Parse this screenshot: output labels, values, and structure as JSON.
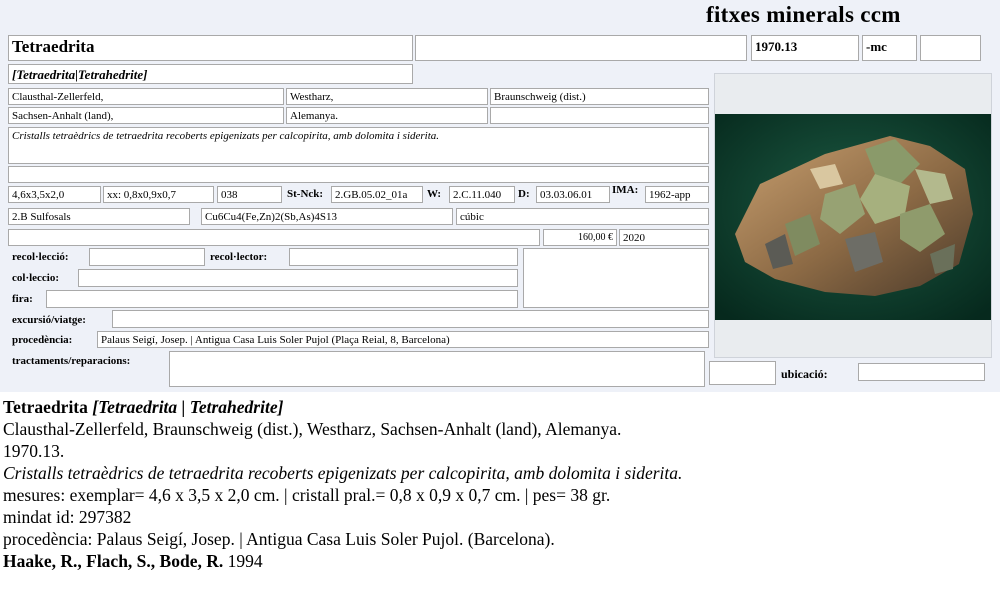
{
  "brand": "fitxes minerals ccm",
  "card": {
    "name": "Tetraedrita",
    "catalog": "1970.13",
    "suffix": "-mc",
    "synonyms": "[Tetraedrita|Tetrahedrite]",
    "locality": [
      "Clausthal-Zellerfeld,",
      "Westharz,",
      "Braunschweig (dist.)"
    ],
    "region": [
      "Sachsen-Anhalt (land),",
      "Alemanya."
    ],
    "description": "Cristalls tetraèdrics de tetraedrita recoberts epigenizats per calcopirita, amb dolomita i siderita.",
    "measures": {
      "size": "4,6x3,5x2,0",
      "crystal": "xx: 0,8x0,9x0,7",
      "weight": "038",
      "strunz_label": "St-Nck:",
      "strunz": "2.GB.05.02_01a",
      "w_label": "W:",
      "w": "2.C.11.040",
      "d_label": "D:",
      "d": "03.03.06.01",
      "ima_label": "IMA:",
      "ima": "1962-app"
    },
    "classification": {
      "group": "2.B Sulfosals",
      "formula": "Cu6Cu4(Fe,Zn)2(Sb,As)4S13",
      "system": "cúbic"
    },
    "price": "160,00 €",
    "year": "2020",
    "labels": {
      "recollection": "recol·lecció:",
      "collector": "recol·lector:",
      "collection": "col·leccio:",
      "fair": "fira:",
      "trip": "excursió/viatge:",
      "provenance": "procedència:",
      "treatments": "tractaments/reparacions:",
      "location": "ubicació:"
    },
    "provenance": "Palaus Seigí, Josep. | Antigua Casa Luis Soler Pujol (Plaça Reial, 8, Barcelona)"
  },
  "summary": {
    "name": "Tetraedrita",
    "synonyms": "[Tetraedrita | Tetrahedrite]",
    "locality": "Clausthal-Zellerfeld, Braunschweig (dist.), Westharz, Sachsen-Anhalt (land), Alemanya.",
    "catalog": "1970.13.",
    "description": "Cristalls tetraèdrics de tetraedrita recoberts epigenizats per calcopirita, amb dolomita i siderita.",
    "measures": "mesures: exemplar= 4,6 x 3,5 x 2,0 cm. | cristall pral.= 0,8 x 0,9 x 0,7 cm. | pes= 38 gr.",
    "mindat": "mindat id: 297382",
    "provenance": "procedència: Palaus Seigí, Josep. | Antigua Casa Luis Soler Pujol. (Barcelona).",
    "reference_authors": "Haake, R., Flach, S., Bode, R.",
    "reference_year": "1994"
  },
  "colors": {
    "card_background": "#eef1f8",
    "field_border": "#a9a9a9",
    "photo_background": "#0b3a2a"
  }
}
